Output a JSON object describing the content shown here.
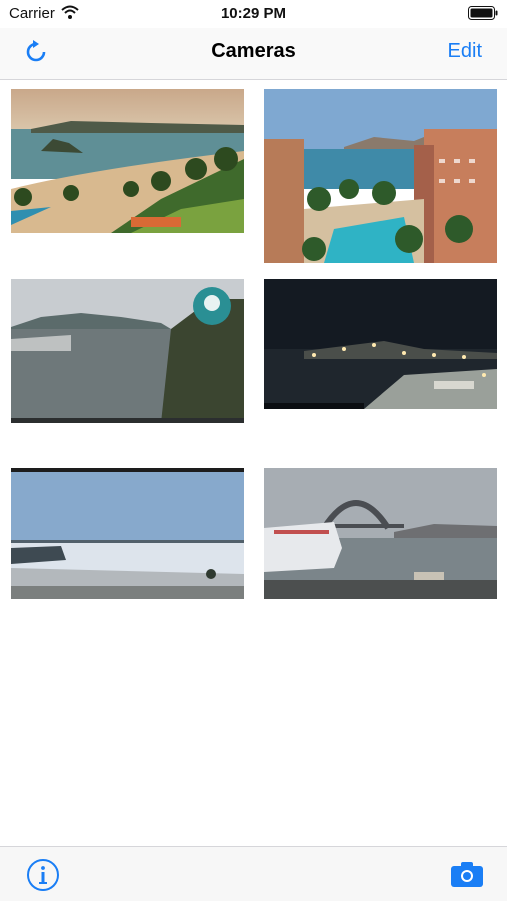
{
  "status": {
    "carrier": "Carrier",
    "time": "10:29 PM"
  },
  "nav": {
    "title": "Cameras",
    "edit_label": "Edit"
  },
  "colors": {
    "accent": "#1a7ef5"
  },
  "icons": {
    "refresh": "refresh-icon",
    "info": "info-icon",
    "camera": "camera-icon"
  },
  "cameras": [
    {
      "scene": "tropical bay beach"
    },
    {
      "scene": "resort pool and cape"
    },
    {
      "scene": "lake with Pacifica logo"
    },
    {
      "scene": "harbor at night"
    },
    {
      "scene": "frozen lake shore"
    },
    {
      "scene": "harbour bridge with cruise ship"
    }
  ]
}
